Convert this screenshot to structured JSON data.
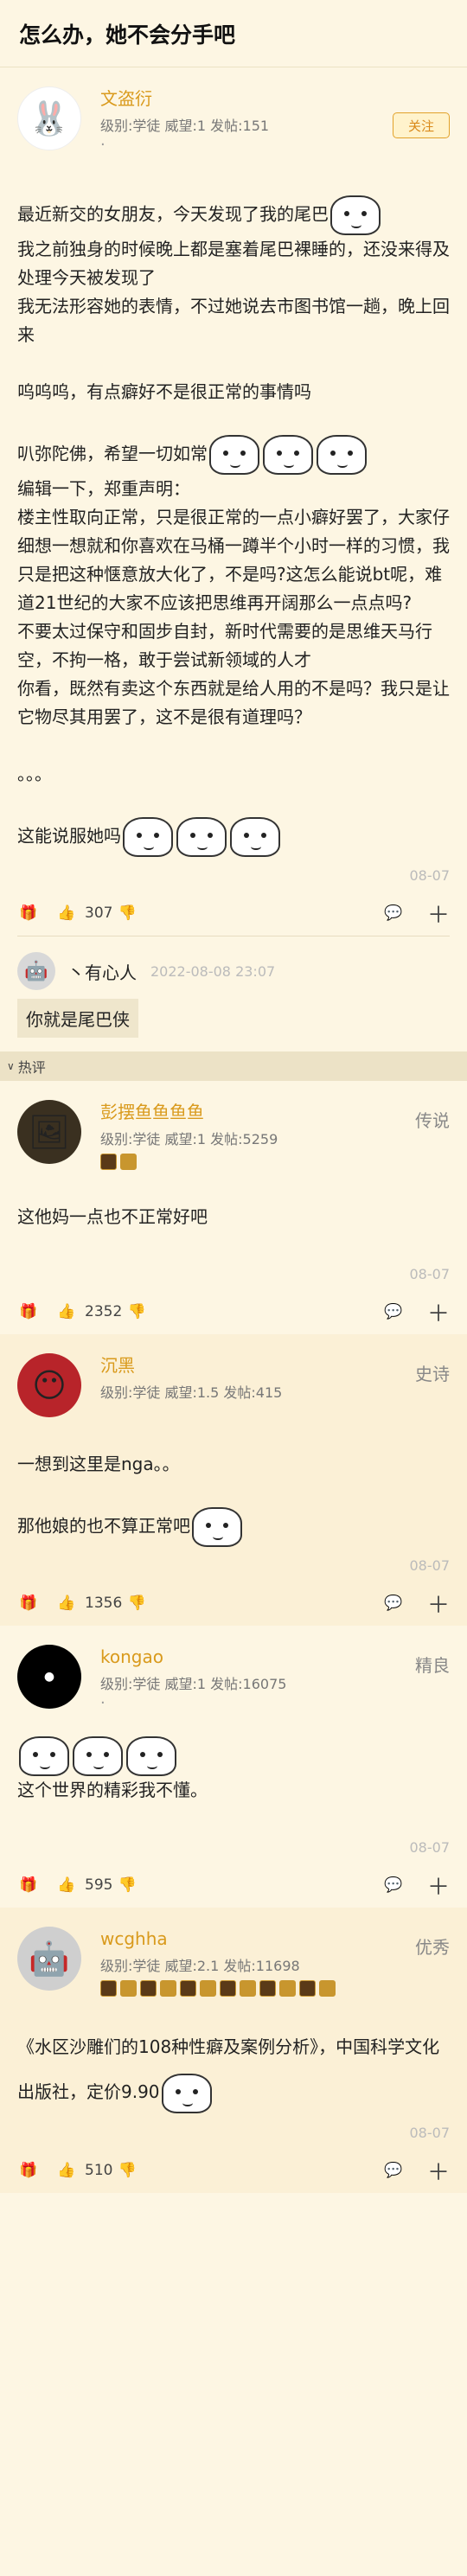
{
  "title": "怎么办，她不会分手吧",
  "op": {
    "name": "文盗衍",
    "meta": "级别:学徒 威望:1 发帖:151",
    "follow": "关注",
    "lines": [
      "最近新交的女朋友，今天发现了我的尾巴",
      "我之前独身的时候晚上都是塞着尾巴裸睡的，还没来得及处理今天被发现了",
      "我无法形容她的表情，不过她说去市图书馆一趟，晚上回来",
      "",
      "呜呜呜，有点癖好不是很正常的事情吗",
      "",
      "叭弥陀佛，希望一切如常",
      "编辑一下，郑重声明：",
      "楼主性取向正常，只是很正常的一点小癖好罢了，大家仔细想一想就和你喜欢在马桶一蹲半个小时一样的习惯，我只是把这种惬意放大化了，不是吗?这怎么能说bt呢，难道21世纪的大家不应该把思维再开阔那么一点点吗?",
      "不要太过保守和固步自封，新时代需要的是思维天马行空，不拘一格，敢于尝试新领域的人才",
      "你看，既然有卖这个东西就是给人用的不是吗？我只是让它物尽其用罢了，这不是很有道理吗？",
      "",
      "。。。",
      "",
      "这能说服她吗"
    ],
    "stamp": "08-07",
    "likes": "307",
    "reply": {
      "name": "丶有心人",
      "time": "2022-08-08 23:07",
      "text": "你就是尾巴侠"
    }
  },
  "hot_label": "热评",
  "comments": [
    {
      "name": "彭摆鱼鱼鱼鱼",
      "meta": "级别:学徒 威望:1 发帖:5259",
      "rank": "传说",
      "lines": [
        "这他妈一点也不正常好吧"
      ],
      "stamp": "08-07",
      "likes": "2352"
    },
    {
      "name": "沉黑",
      "meta": "级别:学徒 威望:1.5 发帖:415",
      "rank": "史诗",
      "lines": [
        "一想到这里是nga。。",
        "",
        "那他娘的也不算正常吧"
      ],
      "stamp": "08-07",
      "likes": "1356"
    },
    {
      "name": "kongao",
      "meta": "级别:学徒 威望:1 发帖:16075",
      "rank": "精良",
      "lines": [
        "",
        "这个世界的精彩我不懂。"
      ],
      "stamp": "08-07",
      "likes": "595"
    },
    {
      "name": "wcghha",
      "meta": "级别:学徒 威望:2.1 发帖:11698",
      "rank": "优秀",
      "lines": [
        "《水区沙雕们的108种性癖及案例分析》，中国科学文化出版社，定价9.90"
      ],
      "stamp": "08-07",
      "likes": "510"
    }
  ],
  "icons": {
    "gift": "gift-icon",
    "like": "thumbs-up-icon",
    "dislike": "thumbs-down-icon",
    "comment": "comment-icon",
    "more": "plus-icon"
  },
  "colors": {
    "name": "#d99a1c",
    "bg": "#fdf6e3"
  }
}
